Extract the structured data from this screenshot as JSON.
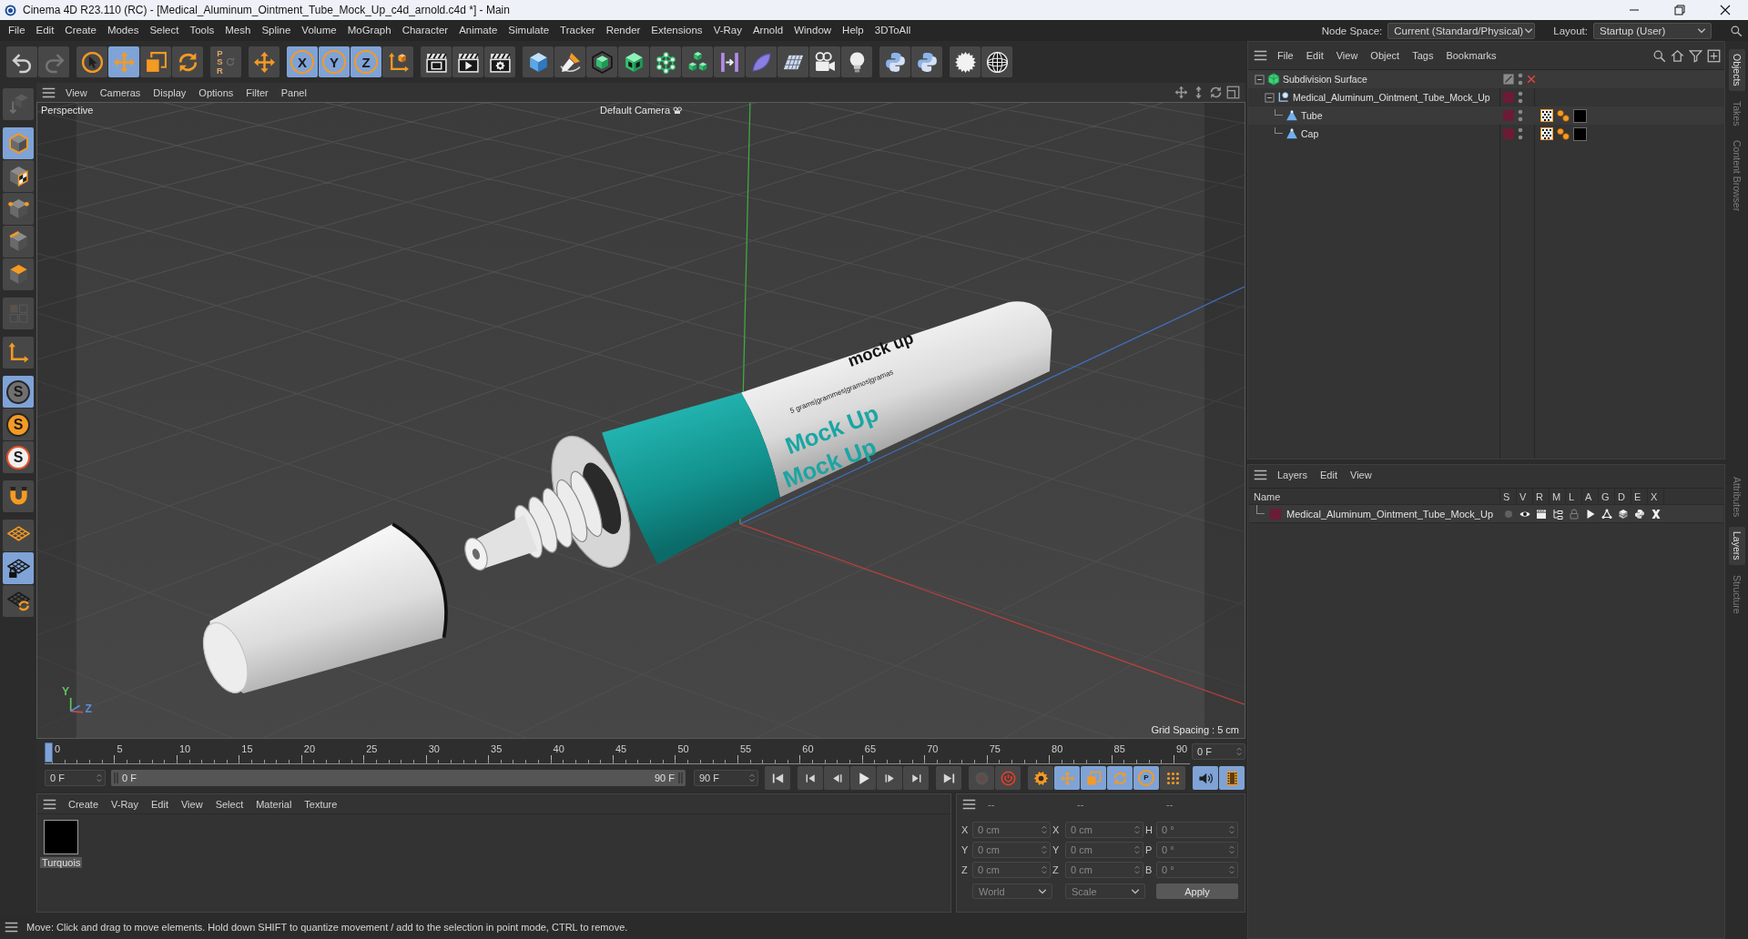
{
  "window": {
    "title": "Cinema 4D R23.110 (RC) - [Medical_Aluminum_Ointment_Tube_Mock_Up_c4d_arnold.c4d *] - Main"
  },
  "menu_bar": {
    "items": [
      "File",
      "Edit",
      "Create",
      "Modes",
      "Select",
      "Tools",
      "Mesh",
      "Spline",
      "Volume",
      "MoGraph",
      "Character",
      "Animate",
      "Simulate",
      "Tracker",
      "Render",
      "Extensions",
      "V-Ray",
      "Arnold",
      "Window",
      "Help",
      "3DToAll"
    ],
    "node_space": {
      "label": "Node Space:",
      "value": "Current (Standard/Physical)"
    },
    "layout": {
      "label": "Layout:",
      "value": "Startup (User)"
    }
  },
  "toolbar": {
    "groups": [
      {
        "buttons": [
          {
            "selected": false,
            "disabled": false
          },
          {
            "selected": false,
            "disabled": true
          }
        ]
      },
      {
        "buttons": [
          {
            "selected": false,
            "disabled": false
          },
          {
            "selected": true,
            "disabled": false
          },
          {
            "selected": false,
            "disabled": false
          },
          {
            "selected": false,
            "disabled": false
          }
        ]
      },
      {
        "buttons": [
          {
            "label": "PSR",
            "selected": false,
            "disabled": true
          }
        ]
      },
      {
        "buttons": [
          {
            "selected": false,
            "disabled": false
          }
        ]
      },
      {
        "buttons": [
          {
            "label": "X",
            "selected": true,
            "disabled": false
          },
          {
            "label": "Y",
            "selected": true,
            "disabled": false
          },
          {
            "label": "Z",
            "selected": true,
            "disabled": false
          },
          {
            "selected": false,
            "disabled": false
          }
        ]
      },
      {
        "buttons": [
          {
            "selected": false,
            "disabled": false
          },
          {
            "selected": false,
            "disabled": false
          },
          {
            "selected": false,
            "disabled": false
          }
        ]
      },
      {
        "buttons": [
          {
            "selected": false,
            "disabled": false
          },
          {
            "selected": false,
            "disabled": false
          },
          {
            "selected": false,
            "disabled": false
          },
          {
            "selected": false,
            "disabled": false
          },
          {
            "selected": false,
            "disabled": false
          },
          {
            "selected": false,
            "disabled": false
          },
          {
            "selected": false,
            "disabled": false
          },
          {
            "selected": false,
            "disabled": false
          },
          {
            "selected": false,
            "disabled": false
          },
          {
            "selected": false,
            "disabled": false
          },
          {
            "selected": false,
            "disabled": false
          }
        ]
      },
      {
        "buttons": [
          {
            "selected": false,
            "disabled": false
          },
          {
            "selected": false,
            "disabled": false
          }
        ]
      },
      {
        "buttons": [
          {
            "selected": false,
            "disabled": false
          },
          {
            "selected": false,
            "disabled": false
          }
        ]
      }
    ]
  },
  "mode_toolbar": {
    "groups": [
      {
        "buttons": [
          {
            "selected": false,
            "disabled": true
          }
        ]
      },
      {
        "buttons": [
          {
            "selected": true,
            "disabled": false
          },
          {
            "selected": false,
            "disabled": false
          },
          {
            "selected": false,
            "disabled": false
          },
          {
            "selected": false,
            "disabled": false
          },
          {
            "selected": false,
            "disabled": false
          }
        ]
      },
      {
        "buttons": [
          {
            "selected": false,
            "disabled": true
          }
        ]
      },
      {
        "buttons": [
          {
            "selected": false,
            "disabled": false
          }
        ]
      },
      {
        "buttons": [
          {
            "label": "S",
            "selected": true,
            "disabled": false
          },
          {
            "label": "S",
            "selected": false,
            "disabled": false
          },
          {
            "label": "S",
            "selected": false,
            "disabled": false
          }
        ]
      },
      {
        "buttons": [
          {
            "selected": false,
            "disabled": false
          }
        ]
      },
      {
        "buttons": [
          {
            "selected": false,
            "disabled": false
          },
          {
            "selected": true,
            "disabled": false
          },
          {
            "selected": false,
            "disabled": false
          }
        ]
      }
    ]
  },
  "viewport": {
    "menu": [
      "View",
      "Cameras",
      "Display",
      "Options",
      "Filter",
      "Panel"
    ],
    "projection": "Perspective",
    "camera": "Default Camera",
    "grid_spacing": "Grid Spacing : 5 cm",
    "axis_labels": [
      {
        "label": "Y",
        "color": "#5cc45c"
      },
      {
        "label": "Z",
        "color": "#5a8fe0"
      }
    ],
    "model_texts": [
      {
        "kind": "brand",
        "text": "mock up"
      },
      {
        "kind": "weight",
        "text": "5 grams|grammes|gramos|gramas"
      },
      {
        "kind": "title",
        "text": "Mock Up"
      },
      {
        "kind": "title",
        "text": "Mock Up"
      }
    ]
  },
  "timeline": {
    "ticks": [
      "0",
      "5",
      "10",
      "15",
      "20",
      "25",
      "30",
      "35",
      "40",
      "45",
      "50",
      "55",
      "60",
      "65",
      "70",
      "75",
      "80",
      "85",
      "90"
    ],
    "level": 0,
    "current_frame": "0 F"
  },
  "transport": {
    "start_frame": "0 F",
    "range": {
      "start": "0 F",
      "end": "90 F",
      "level": 1
    },
    "end_frame": "90 F",
    "groups": [
      {
        "buttons": [
          {
            "selected": false,
            "disabled": false
          }
        ]
      },
      {
        "buttons": [
          {
            "selected": false,
            "disabled": false
          },
          {
            "selected": false,
            "disabled": false
          },
          {
            "selected": false,
            "disabled": false
          },
          {
            "selected": false,
            "disabled": false
          },
          {
            "selected": false,
            "disabled": false
          }
        ]
      },
      {
        "buttons": [
          {
            "selected": false,
            "disabled": false
          }
        ]
      },
      {
        "buttons": [
          {
            "selected": false,
            "disabled": true
          },
          {
            "selected": false,
            "disabled": false
          }
        ]
      },
      {
        "buttons": [
          {
            "selected": false,
            "disabled": false
          },
          {
            "selected": true,
            "disabled": false
          },
          {
            "selected": true,
            "disabled": false
          },
          {
            "selected": true,
            "disabled": false
          },
          {
            "label": "P",
            "selected": true,
            "disabled": false
          },
          {
            "selected": false,
            "disabled": false
          }
        ]
      },
      {
        "buttons": [
          {
            "selected": true,
            "disabled": false
          },
          {
            "selected": true,
            "disabled": false
          }
        ]
      }
    ]
  },
  "material_manager": {
    "menu": [
      "Create",
      "V-Ray",
      "Edit",
      "View",
      "Select",
      "Material",
      "Texture"
    ],
    "materials": [
      {
        "name": "Turquois",
        "selected": true
      }
    ]
  },
  "coordinates": {
    "headers": [
      "--",
      "--",
      "--"
    ],
    "disabled": true,
    "rows": [
      [
        {
          "label": "X",
          "value": "0 cm"
        },
        {
          "label": "X",
          "value": "0 cm"
        },
        {
          "label": "H",
          "value": "0 °"
        }
      ],
      [
        {
          "label": "Y",
          "value": "0 cm"
        },
        {
          "label": "Y",
          "value": "0 cm"
        },
        {
          "label": "P",
          "value": "0 °"
        }
      ],
      [
        {
          "label": "Z",
          "value": "0 cm"
        },
        {
          "label": "Z",
          "value": "0 cm"
        },
        {
          "label": "B",
          "value": "0 °"
        }
      ]
    ],
    "dropdowns": [
      "World",
      "Scale"
    ],
    "apply": "Apply"
  },
  "status_bar": {
    "text": "Move: Click and drag to move elements. Hold down SHIFT to quantize movement / add to the selection in point mode, CTRL to remove."
  },
  "objects": {
    "menu": [
      "File",
      "Edit",
      "View",
      "Object",
      "Tags",
      "Bookmarks"
    ],
    "tree": [
      {
        "kind": "subdivision",
        "name": "Subdivision Surface",
        "expanded": true,
        "enabled": false,
        "children": [
          {
            "kind": "null",
            "name": "Medical_Aluminum_Ointment_Tube_Mock_Up",
            "color": "#6b1c35",
            "expanded": true,
            "children": [
              {
                "kind": "polygon",
                "name": "Tube",
                "color": "#6b1c35",
                "tags": [
                  {
                    "kind": "uvw"
                  },
                  {
                    "kind": "phong"
                  },
                  {
                    "kind": "material"
                  }
                ]
              },
              {
                "kind": "polygon",
                "name": "Cap",
                "color": "#6b1c35",
                "tags": [
                  {
                    "kind": "uvw"
                  },
                  {
                    "kind": "phong"
                  },
                  {
                    "kind": "material"
                  }
                ]
              }
            ]
          }
        ]
      }
    ]
  },
  "layers": {
    "menu": [
      "Layers",
      "Edit",
      "View"
    ],
    "columns": [
      "Name",
      "S",
      "V",
      "R",
      "M",
      "L",
      "A",
      "G",
      "D",
      "E",
      "X"
    ],
    "rows": [
      {
        "name": "Medical_Aluminum_Ointment_Tube_Mock_Up",
        "color": "#6b1c35",
        "switches": [
          {
            "on": false
          },
          {
            "on": true
          },
          {
            "on": true
          },
          {
            "on": true
          },
          {
            "on": false
          },
          {
            "on": true
          },
          {
            "on": true
          },
          {
            "on": true
          },
          {
            "on": true
          },
          {
            "on": true
          }
        ]
      }
    ]
  },
  "side_tabs": {
    "top": [
      {
        "label": "Objects",
        "selected": true
      },
      {
        "label": "Takes",
        "selected": false
      },
      {
        "label": "Content Browser",
        "selected": false
      }
    ],
    "bottom": [
      {
        "label": "Attributes",
        "selected": false
      },
      {
        "label": "Layers",
        "selected": true
      },
      {
        "label": "Structure",
        "selected": false
      }
    ]
  }
}
